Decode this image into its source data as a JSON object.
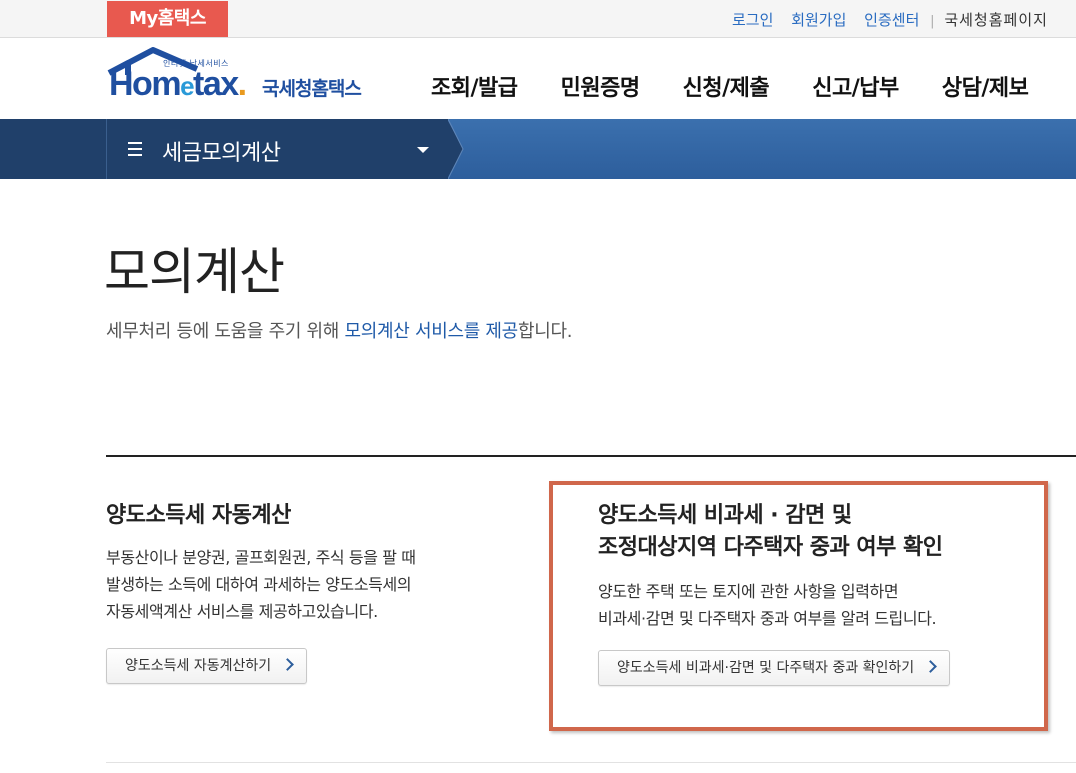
{
  "topbar": {
    "my_hometax": "My홈택스",
    "login": "로그인",
    "signup": "회원가입",
    "cert_center": "인증센터",
    "separator": "|",
    "nts_page": "국세청홈페이지"
  },
  "logo": {
    "sub": "인터넷 납세서비스",
    "word_ho": "Hom",
    "word_e": "e",
    "word_tax": "tax",
    "word_dot": ".",
    "korean": "국세청홈택스"
  },
  "gnb": {
    "items": [
      {
        "label": "조회/발급"
      },
      {
        "label": "민원증명"
      },
      {
        "label": "신청/제출"
      },
      {
        "label": "신고/납부"
      },
      {
        "label": "상담/제보"
      }
    ]
  },
  "menubar": {
    "title": "세금모의계산"
  },
  "page": {
    "title": "모의계산",
    "desc_before": "세무처리 등에 도움을 주기 위해 ",
    "desc_highlight": "모의계산 서비스를 제공",
    "desc_after": "합니다."
  },
  "cards": [
    {
      "title_line1": "양도소득세 자동계산",
      "text_lines": [
        "부동산이나 분양권, 골프회원권, 주식 등을 팔 때",
        "발생하는 소득에 대하여 과세하는 양도소득세의",
        "자동세액계산 서비스를 제공하고있습니다."
      ],
      "button_label": "양도소득세 자동계산하기"
    },
    {
      "title_line1": "양도소득세 비과세 · 감면 및",
      "title_line2": "조정대상지역 다주택자 중과 여부 확인",
      "text_lines": [
        "양도한 주택 또는 토지에 관한 사항을 입력하면",
        "비과세·감면 및 다주택자 중과 여부를 알려 드립니다."
      ],
      "button_label": "양도소득세 비과세·감면 및 다주택자 중과 확인하기"
    }
  ],
  "colors": {
    "brand_red": "#e8594f",
    "brand_blue": "#1f4fa0",
    "menubar_dark": "#20406a",
    "highlight_border": "#d0674b"
  }
}
